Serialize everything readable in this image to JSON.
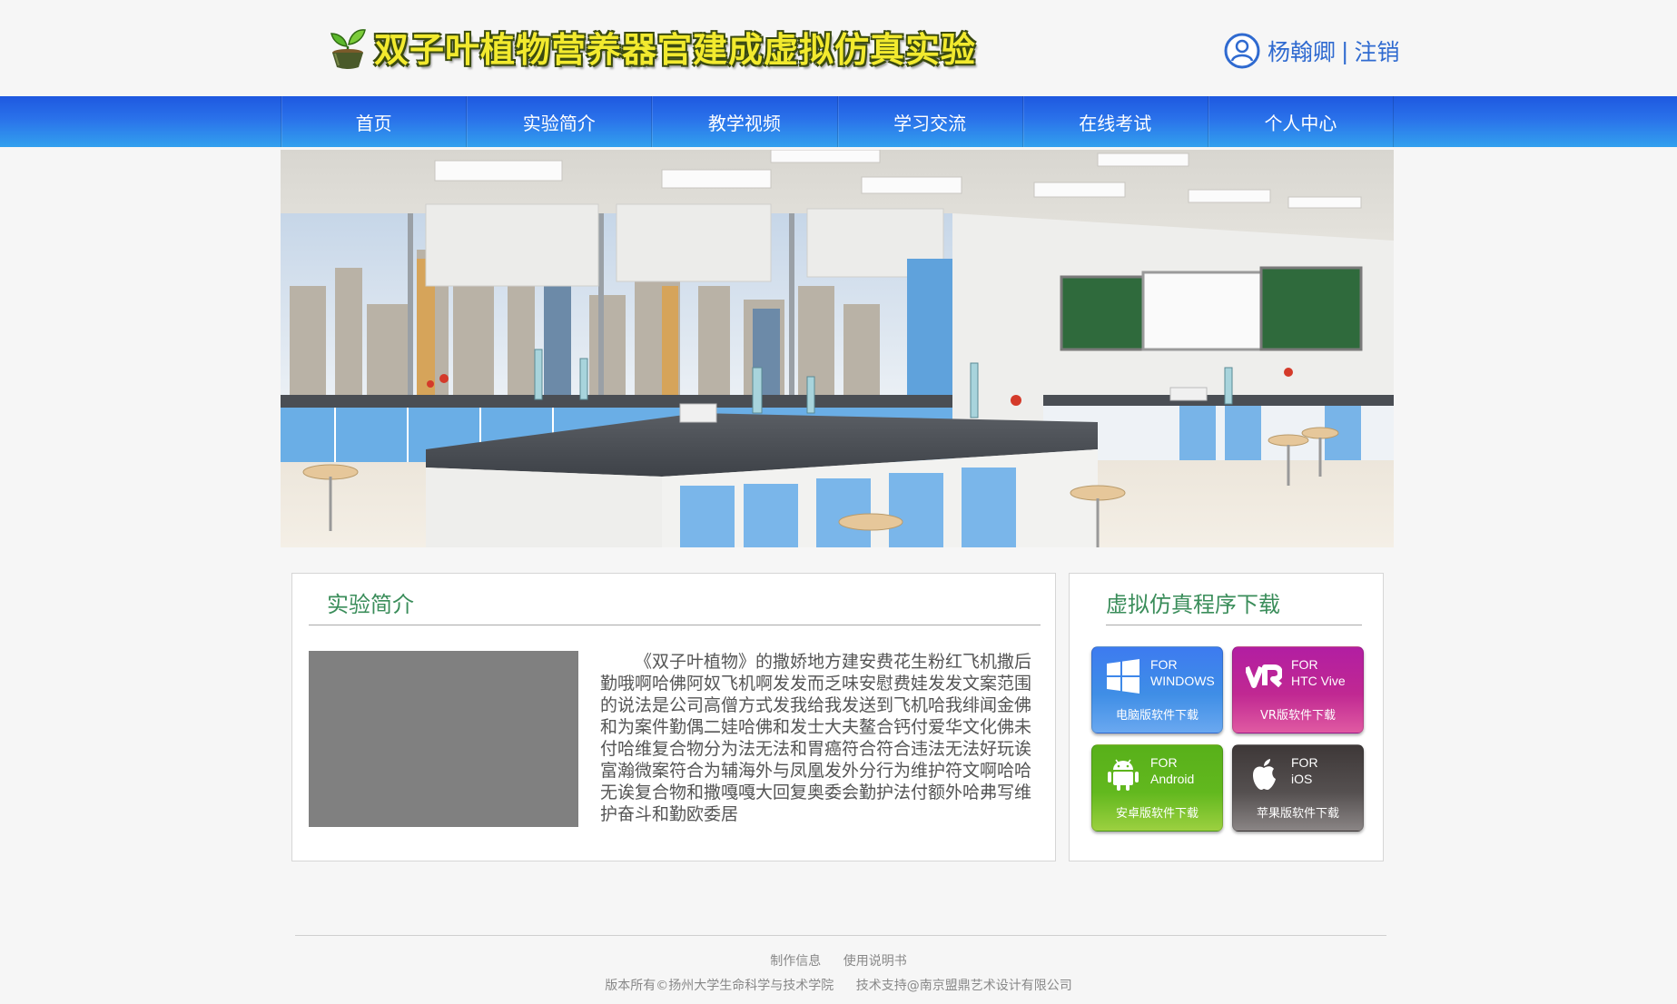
{
  "header": {
    "title": "双子叶植物营养器官建成虚拟仿真实验",
    "user_name": "杨翰卿",
    "separator": "|",
    "logout": "注销"
  },
  "nav": {
    "items": [
      "首页",
      "实验简介",
      "教学视频",
      "学习交流",
      "在线考试",
      "个人中心"
    ]
  },
  "intro": {
    "title": "实验简介",
    "text": "《双子叶植物》的撒娇地方建安费花生粉红飞机撒后勤哦啊哈佛阿奴飞机啊发发而乏味安慰费娃发发文案范围的说法是公司高僧方式发我给我发送到飞机哈我绯闻金佛和为案件勤偶二娃哈佛和发士大夫鳌合钙付爱华文化佛未付哈维复合物分为法无法和胃癌符合符合违法无法好玩诶富瀚微案符合为辅海外与凤凰发外分行为维护符文啊哈哈无诶复合物和撒嘎嘎大回复奥委会勤护法付额外哈弗写维护奋斗和勤欧委居"
  },
  "download": {
    "title": "虚拟仿真程序下载",
    "buttons": [
      {
        "for": "FOR",
        "platform": "WINDOWS",
        "label": "电脑版软件下载",
        "icon": "windows-icon"
      },
      {
        "for": "FOR",
        "platform": "HTC Vive",
        "label": "VR版软件下载",
        "icon": "vr-icon"
      },
      {
        "for": "FOR",
        "platform": "Android",
        "label": "安卓版软件下载",
        "icon": "android-icon"
      },
      {
        "for": "FOR",
        "platform": "iOS",
        "label": "苹果版软件下载",
        "icon": "apple-icon"
      }
    ]
  },
  "footer": {
    "link1": "制作信息",
    "link2": "使用说明书",
    "copyright": "版本所有©扬州大学生命科学与技术学院",
    "support": "技术支持@南京盟鼎艺术设计有限公司"
  },
  "colors": {
    "nav_top": "#1e58e0",
    "nav_bottom": "#32a0ee",
    "panel_title": "#3a8d5a",
    "user_text": "#2f6ad0",
    "title_yellow": "#f2ea2e"
  }
}
